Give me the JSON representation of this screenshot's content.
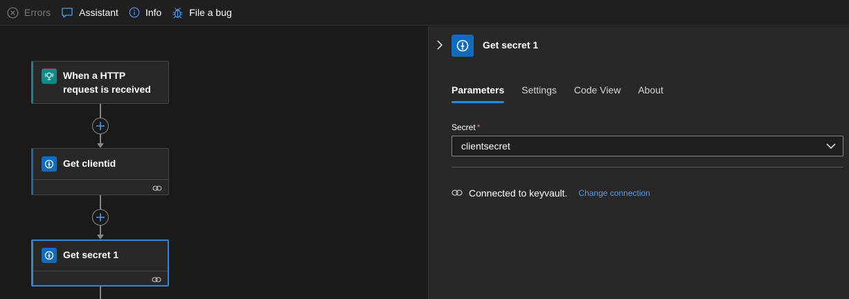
{
  "toolbar": {
    "errors_label": "Errors",
    "assistant_label": "Assistant",
    "info_label": "Info",
    "bug_label": "File a bug"
  },
  "workflow": {
    "trigger": {
      "title": "When a HTTP request is received",
      "icon": "http-request-icon"
    },
    "actions": [
      {
        "title": "Get clientid",
        "icon": "key-vault-icon"
      },
      {
        "title": "Get secret 1",
        "icon": "key-vault-icon"
      }
    ]
  },
  "panel": {
    "title": "Get secret 1",
    "tabs": [
      "Parameters",
      "Settings",
      "Code View",
      "About"
    ],
    "active_tab": "Parameters",
    "secret_label": "Secret",
    "required_marker": "*",
    "secret_value": "clientsecret",
    "connection_text": "Connected to keyvault.",
    "change_connection": "Change connection"
  },
  "colors": {
    "accent": "#2b88d8",
    "link": "#479ef5",
    "trigger": "#0e8a8a",
    "action": "#0f6cbd"
  }
}
